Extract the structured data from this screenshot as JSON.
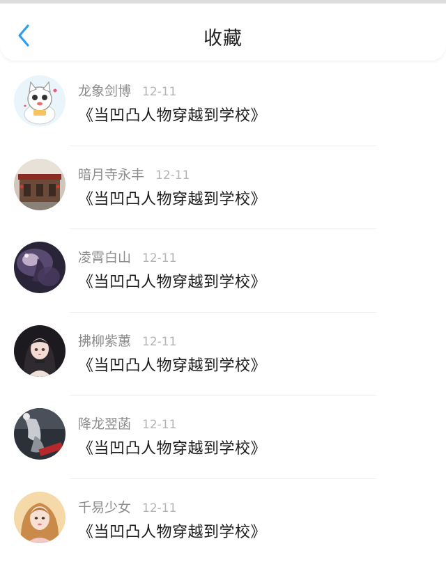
{
  "header": {
    "back_icon": "chevron-left-icon",
    "title": "收藏"
  },
  "colors": {
    "accent": "#2a9df4",
    "username": "#8c8c8c",
    "date": "#b4b4b4",
    "title": "#1a1a1a"
  },
  "items": [
    {
      "username": "龙象剑博",
      "date": "12-11",
      "title": "《当凹凸人物穿越到学校》",
      "avatar": "cartoon-cat-avatar"
    },
    {
      "username": "暗月寺永丰",
      "date": "12-11",
      "title": "《当凹凸人物穿越到学校》",
      "avatar": "building-photo-avatar"
    },
    {
      "username": "凌霄白山",
      "date": "12-11",
      "title": "《当凹凸人物穿越到学校》",
      "avatar": "dark-anime-avatar"
    },
    {
      "username": "拂柳紫蕙",
      "date": "12-11",
      "title": "《当凹凸人物穿越到学校》",
      "avatar": "anime-girl-avatar"
    },
    {
      "username": "降龙翌菡",
      "date": "12-11",
      "title": "《当凹凸人物穿越到学校》",
      "avatar": "dark-figure-avatar"
    },
    {
      "username": "千易少女",
      "date": "12-11",
      "title": "《当凹凸人物穿越到学校》",
      "avatar": "girl-photo-avatar"
    }
  ]
}
